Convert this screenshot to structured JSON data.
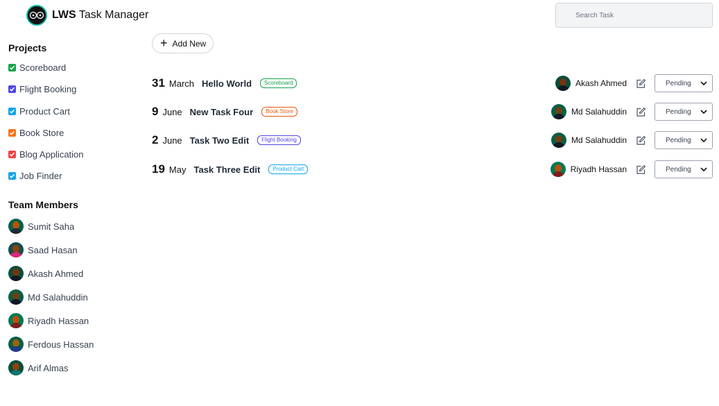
{
  "app": {
    "brand_bold": "LWS",
    "brand_rest": " Task Manager"
  },
  "search": {
    "placeholder": "Search Task"
  },
  "sidebar": {
    "projects_title": "Projects",
    "projects": [
      {
        "name": "Scoreboard",
        "color": "#16a34a"
      },
      {
        "name": "Flight Booking",
        "color": "#4f46e5"
      },
      {
        "name": "Product Cart",
        "color": "#0ea5e9"
      },
      {
        "name": "Book Store",
        "color": "#f97316"
      },
      {
        "name": "Blog Application",
        "color": "#ef4444"
      },
      {
        "name": "Job Finder",
        "color": "#0ea5e9"
      }
    ],
    "team_title": "Team Members",
    "members": [
      {
        "name": "Sumit Saha"
      },
      {
        "name": "Saad Hasan"
      },
      {
        "name": "Akash Ahmed"
      },
      {
        "name": "Md Salahuddin"
      },
      {
        "name": "Riyadh Hassan"
      },
      {
        "name": "Ferdous Hassan"
      },
      {
        "name": "Arif Almas"
      }
    ]
  },
  "toolbar": {
    "add_label": "Add New"
  },
  "tasks": [
    {
      "day": "31",
      "month": "March",
      "title": "Hello World",
      "project": "Scoreboard",
      "project_color": "#16a34a",
      "assignee": "Akash Ahmed",
      "status": "Pending"
    },
    {
      "day": "9",
      "month": "June",
      "title": "New Task Four",
      "project": "Book Store",
      "project_color": "#ea580c",
      "assignee": "Md Salahuddin",
      "status": "Pending"
    },
    {
      "day": "2",
      "month": "June",
      "title": "Task Two Edit",
      "project": "Flight Booking",
      "project_color": "#4f46e5",
      "assignee": "Md Salahuddin",
      "status": "Pending"
    },
    {
      "day": "19",
      "month": "May",
      "title": "Task Three Edit",
      "project": "Product Cart",
      "project_color": "#0ea5e9",
      "assignee": "Riyadh Hassan",
      "status": "Pending"
    }
  ]
}
